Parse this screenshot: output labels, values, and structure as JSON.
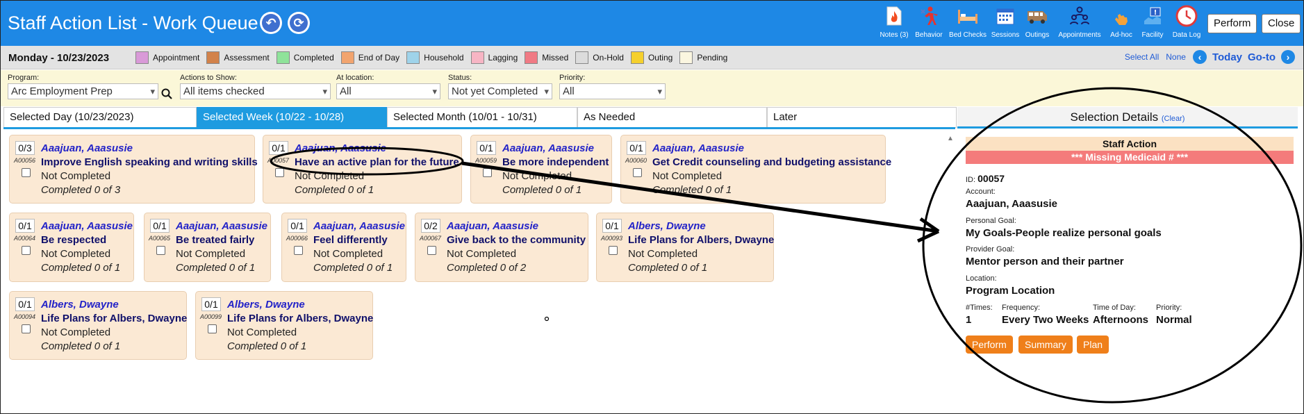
{
  "header": {
    "title": "Staff Action List - Work Queue",
    "tools": [
      {
        "label": "Notes (3)",
        "icon": "notes-icon"
      },
      {
        "label": "Behavior",
        "icon": "behavior-icon"
      },
      {
        "label": "Bed Checks",
        "icon": "bed-icon"
      },
      {
        "label": "Sessions",
        "icon": "calendar-icon"
      },
      {
        "label": "Outings",
        "icon": "van-icon"
      },
      {
        "label": "Appointments",
        "icon": "people-icon"
      },
      {
        "label": "Ad-hoc",
        "icon": "hand-icon"
      },
      {
        "label": "Facility",
        "icon": "facility-icon"
      },
      {
        "label": "Data Log",
        "icon": "clock-icon"
      }
    ],
    "perform_label": "Perform",
    "close_label": "Close"
  },
  "legend_bar": {
    "date": "Monday - 10/23/2023",
    "items": [
      {
        "label": "Appointment",
        "color": "#d99ad8"
      },
      {
        "label": "Assessment",
        "color": "#d2824a"
      },
      {
        "label": "Completed",
        "color": "#8fe39a"
      },
      {
        "label": "End of Day",
        "color": "#f2a46e"
      },
      {
        "label": "Household",
        "color": "#9fd3ea"
      },
      {
        "label": "Lagging",
        "color": "#f7b5c4"
      },
      {
        "label": "Missed",
        "color": "#f07a84"
      },
      {
        "label": "On-Hold",
        "color": "#dcdcdc"
      },
      {
        "label": "Outing",
        "color": "#f5d02d"
      },
      {
        "label": "Pending",
        "color": "#fbf6e0"
      }
    ],
    "select_all": "Select All",
    "none": "None",
    "today": "Today",
    "goto": "Go-to"
  },
  "filters": {
    "program": {
      "label": "Program:",
      "value": "Arc Employment Prep"
    },
    "actions": {
      "label": "Actions to Show:",
      "value": "All items checked"
    },
    "location": {
      "label": "At location:",
      "value": "All"
    },
    "status": {
      "label": "Status:",
      "value": "Not yet Completed"
    },
    "priority": {
      "label": "Priority:",
      "value": "All"
    }
  },
  "tabs": [
    {
      "label": "Selected Day (10/23/2023)"
    },
    {
      "label": "Selected Week (10/22 - 10/28)"
    },
    {
      "label": "Selected Month (10/01 - 10/31)"
    },
    {
      "label": "As Needed"
    },
    {
      "label": "Later"
    }
  ],
  "cards": [
    {
      "count": "0/3",
      "id": "A00056",
      "name": "Aaajuan, Aaasusie",
      "goal": "Improve English speaking and writing skills",
      "status": "Not Completed",
      "completed": "Completed 0 of 3"
    },
    {
      "count": "0/1",
      "id": "A00057",
      "name": "Aaajuan, Aaasusie",
      "goal": "Have an active plan for the future",
      "status": "Not Completed",
      "completed": "Completed 0 of 1"
    },
    {
      "count": "0/1",
      "id": "A00059",
      "name": "Aaajuan, Aaasusie",
      "goal": "Be more independent",
      "status": "Not Completed",
      "completed": "Completed 0 of 1"
    },
    {
      "count": "0/1",
      "id": "A00060",
      "name": "Aaajuan, Aaasusie",
      "goal": "Get Credit counseling and budgeting assistance",
      "status": "Not Completed",
      "completed": "Completed 0 of 1"
    },
    {
      "count": "0/1",
      "id": "A00064",
      "name": "Aaajuan, Aaasusie",
      "goal": "Be respected",
      "status": "Not Completed",
      "completed": "Completed 0 of 1"
    },
    {
      "count": "0/1",
      "id": "A00065",
      "name": "Aaajuan, Aaasusie",
      "goal": "Be treated fairly",
      "status": "Not Completed",
      "completed": "Completed 0 of 1"
    },
    {
      "count": "0/1",
      "id": "A00066",
      "name": "Aaajuan, Aaasusie",
      "goal": "Feel differently",
      "status": "Not Completed",
      "completed": "Completed 0 of 1"
    },
    {
      "count": "0/2",
      "id": "A00067",
      "name": "Aaajuan, Aaasusie",
      "goal": "Give back to the community",
      "status": "Not Completed",
      "completed": "Completed 0 of 2"
    },
    {
      "count": "0/1",
      "id": "A00093",
      "name": "Albers, Dwayne",
      "goal": "Life Plans for Albers, Dwayne",
      "status": "Not Completed",
      "completed": "Completed 0 of 1"
    },
    {
      "count": "0/1",
      "id": "A00094",
      "name": "Albers, Dwayne",
      "goal": "Life Plans for Albers, Dwayne",
      "status": "Not Completed",
      "completed": "Completed 0 of 1"
    },
    {
      "count": "0/1",
      "id": "A00099",
      "name": "Albers, Dwayne",
      "goal": "Life Plans for Albers, Dwayne",
      "status": "Not Completed",
      "completed": "Completed 0 of 1"
    }
  ],
  "details": {
    "header": "Selection Details",
    "clear": "(Clear)",
    "title": "Staff Action",
    "alert": "*** Missing Medicaid # ***",
    "id_label": "ID:",
    "id_value": "00057",
    "account_label": "Account:",
    "account_value": "Aaajuan, Aaasusie",
    "personal_goal_label": "Personal Goal:",
    "personal_goal_value": "My Goals-People realize personal goals",
    "provider_goal_label": "Provider Goal:",
    "provider_goal_value": "Mentor person and their partner",
    "location_label": "Location:",
    "location_value": "Program Location",
    "times_label": "#Times:",
    "times_value": "1",
    "frequency_label": "Frequency:",
    "frequency_value": "Every Two Weeks",
    "tod_label": "Time of Day:",
    "tod_value": "Afternoons",
    "priority_label": "Priority:",
    "priority_value": "Normal",
    "buttons": {
      "perform": "Perform",
      "summary": "Summary",
      "plan": "Plan"
    }
  }
}
